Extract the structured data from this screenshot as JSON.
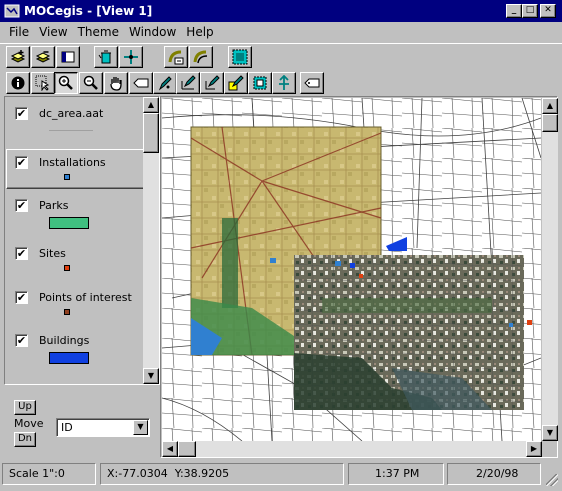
{
  "window": {
    "title": "MOCegis - [View 1]",
    "controls": {
      "minimize": "_",
      "maximize": "□",
      "close": "✕"
    }
  },
  "menu": [
    "File",
    "View",
    "Theme",
    "Window",
    "Help"
  ],
  "toolbar1": [
    {
      "name": "add-theme-button",
      "icon": "add-layer-icon"
    },
    {
      "name": "remove-theme-button",
      "icon": "remove-layer-icon"
    },
    {
      "name": "theme-table-button",
      "icon": "table-icon"
    },
    {
      "name": "delete-button",
      "icon": "trash-icon"
    },
    {
      "name": "add-point-button",
      "icon": "crosshair-icon"
    },
    {
      "name": "route-button",
      "icon": "route-icon"
    },
    {
      "name": "geocode-button",
      "icon": "path-icon"
    },
    {
      "name": "full-extent-button",
      "icon": "extent-icon"
    }
  ],
  "toolbar2": [
    {
      "name": "identify-button",
      "icon": "info-icon"
    },
    {
      "name": "select-button",
      "icon": "pointer-icon"
    },
    {
      "name": "zoom-in-button",
      "icon": "zoom-in-icon"
    },
    {
      "name": "zoom-out-button",
      "icon": "zoom-out-icon"
    },
    {
      "name": "pan-button",
      "icon": "hand-icon"
    },
    {
      "name": "label-button",
      "icon": "label-icon"
    },
    {
      "name": "draw-point-button",
      "icon": "pencil-point-icon"
    },
    {
      "name": "draw-line-button",
      "icon": "pencil-line-icon"
    },
    {
      "name": "draw-polygon-button",
      "icon": "pencil-poly-icon"
    },
    {
      "name": "edit-button",
      "icon": "pencil-edit-icon"
    },
    {
      "name": "select-box-button",
      "icon": "select-box-icon"
    },
    {
      "name": "north-arrow-button",
      "icon": "north-arrow-icon"
    },
    {
      "name": "tag-button",
      "icon": "tag-icon"
    }
  ],
  "legend": {
    "layers": [
      {
        "label": "dc_area.aat",
        "checked": "✔",
        "symbol": "line",
        "color": "#a0a0a0"
      },
      {
        "label": "Installations",
        "checked": "✔",
        "symbol": "point",
        "color": "#3080d0"
      },
      {
        "label": "Parks",
        "checked": "✔",
        "symbol": "fill",
        "color": "#40c080"
      },
      {
        "label": "Sites",
        "checked": "✔",
        "symbol": "point",
        "color": "#e04010"
      },
      {
        "label": "Points of interest",
        "checked": "✔",
        "symbol": "point",
        "color": "#904020"
      },
      {
        "label": "Buildings",
        "checked": "✔",
        "symbol": "fill",
        "color": "#1040e0"
      }
    ]
  },
  "move": {
    "up": "Up",
    "label": "Move",
    "down": "Dn",
    "field": "ID"
  },
  "status": {
    "scale": "Scale 1\":0",
    "x": "X:-77.0304",
    "y": "Y:38.9205",
    "time": "1:37 PM",
    "date": "2/20/98"
  },
  "colors": {
    "titlebar": "#000080",
    "parks": "#40c080",
    "buildings": "#1040e0",
    "water": "#3080d0"
  }
}
